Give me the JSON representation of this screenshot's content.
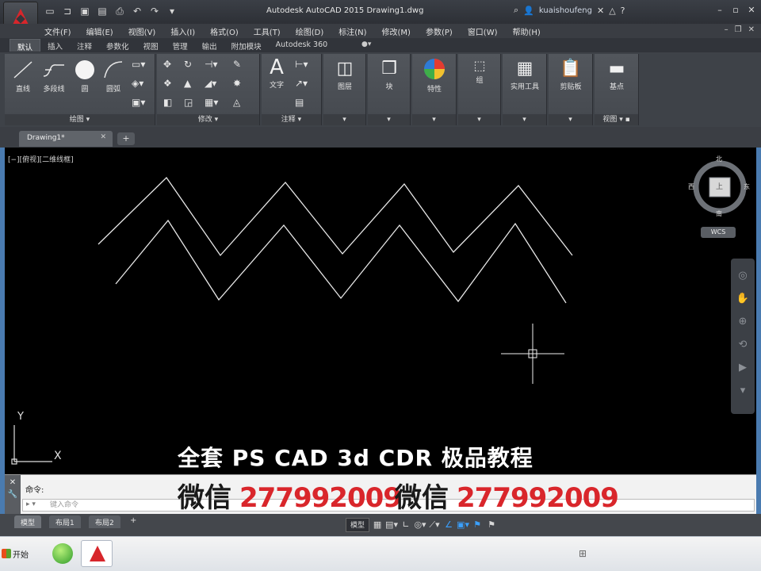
{
  "titlebar": {
    "title": "Autodesk AutoCAD 2015   Drawing1.dwg",
    "user": "kuaishoufeng",
    "help_icon": "?"
  },
  "menubar": {
    "items": [
      "文件(F)",
      "编辑(E)",
      "视图(V)",
      "插入(I)",
      "格式(O)",
      "工具(T)",
      "绘图(D)",
      "标注(N)",
      "修改(M)",
      "参数(P)",
      "窗口(W)",
      "帮助(H)"
    ]
  },
  "ribbon_tabs": [
    "默认",
    "插入",
    "注释",
    "参数化",
    "视图",
    "管理",
    "输出",
    "附加模块",
    "Autodesk 360"
  ],
  "ribbon": {
    "draw": {
      "line": "直线",
      "polyline": "多段线",
      "circle": "圆",
      "arc": "圆弧",
      "footer": "绘图"
    },
    "modify": {
      "footer": "修改"
    },
    "annotation": {
      "text": "文字",
      "footer": "注释"
    },
    "layers": {
      "label": "图层"
    },
    "block": {
      "label": "块"
    },
    "properties": {
      "label": "特性"
    },
    "groups": {
      "label": "组"
    },
    "utilities": {
      "label": "实用工具"
    },
    "clipboard": {
      "label": "剪贴板"
    },
    "view": {
      "base": "基点",
      "footer": "视图"
    }
  },
  "file_tab": {
    "name": "Drawing1*"
  },
  "viewport": {
    "label": "[−][俯视][二维线框]",
    "viewcube": {
      "north": "北",
      "south": "南",
      "east": "东",
      "west": "西",
      "face": "上"
    },
    "wcs": "WCS",
    "ucs_x": "X",
    "ucs_y": "Y"
  },
  "overlay": {
    "line1": "全套 PS CAD 3d CDR   极品教程",
    "wechat_label": "微信",
    "wechat_number": "277992009"
  },
  "command": {
    "history": "命令:",
    "placeholder": "键入命令"
  },
  "layout_tabs": [
    "模型",
    "布局1",
    "布局2"
  ],
  "statusbar": {
    "model": "模型"
  },
  "taskbar": {
    "start": "开始"
  },
  "colors": {
    "accent_red": "#d7262b",
    "drawing_bg": "#000000",
    "ribbon_bg": "#3e4248"
  }
}
